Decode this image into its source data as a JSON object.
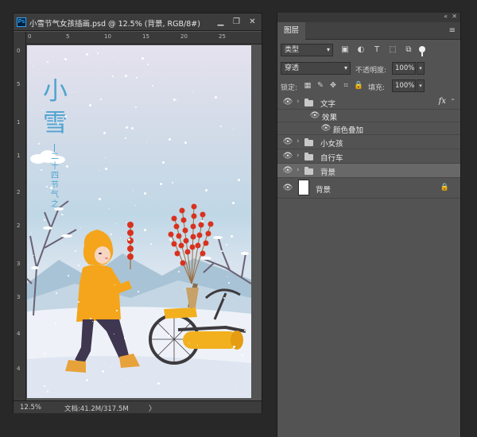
{
  "document": {
    "title": "小雪节气女孩插画.psd @ 12.5% (背景, RGB/8#)",
    "app_icon": "Ps",
    "buttons": {
      "minimize": "▁",
      "maximize": "❐",
      "close": "✕"
    },
    "ruler_top": [
      "0",
      "5",
      "10",
      "15",
      "20",
      "25"
    ],
    "ruler_left": [
      "0",
      "5",
      "1",
      "1",
      "2",
      "2",
      "3",
      "3",
      "4",
      "4"
    ],
    "status": {
      "zoom": "12.5%",
      "doc_info": "文档:41.2M/317.5M",
      "arrow": "〉"
    }
  },
  "artwork": {
    "title_vertical": "小雪",
    "subtitle_vertical": "二十四节气之",
    "colors": {
      "text": "#4fa4d0",
      "coat": "#f4a51c",
      "candy": "#d8321e",
      "wheel": "#f2b01e"
    }
  },
  "layers_panel": {
    "tab_label": "图层",
    "collapse_icon": "«",
    "close_icon": "✕",
    "menu_icon": "≡",
    "filter": {
      "kind_value": "类型",
      "icons": [
        "image-filter-icon",
        "adjustment-filter-icon",
        "type-filter-icon",
        "shape-filter-icon",
        "smart-object-filter-icon"
      ]
    },
    "blend_mode_value": "穿透",
    "opacity_label": "不透明度:",
    "opacity_value": "100%",
    "lock_label": "锁定:",
    "fill_label": "填充:",
    "fill_value": "100%",
    "layers": [
      {
        "name": "文字",
        "type": "group",
        "visible": true,
        "fx": "fx"
      },
      {
        "name": "效果",
        "type": "effects",
        "visible": true
      },
      {
        "name": "颜色叠加",
        "type": "effect",
        "visible": true
      },
      {
        "name": "小女孩",
        "type": "group",
        "visible": true
      },
      {
        "name": "自行车",
        "type": "group",
        "visible": true
      },
      {
        "name": "背景",
        "type": "group",
        "visible": true,
        "selected": true
      },
      {
        "name": "背景",
        "type": "layer",
        "visible": true,
        "locked": true
      }
    ]
  }
}
